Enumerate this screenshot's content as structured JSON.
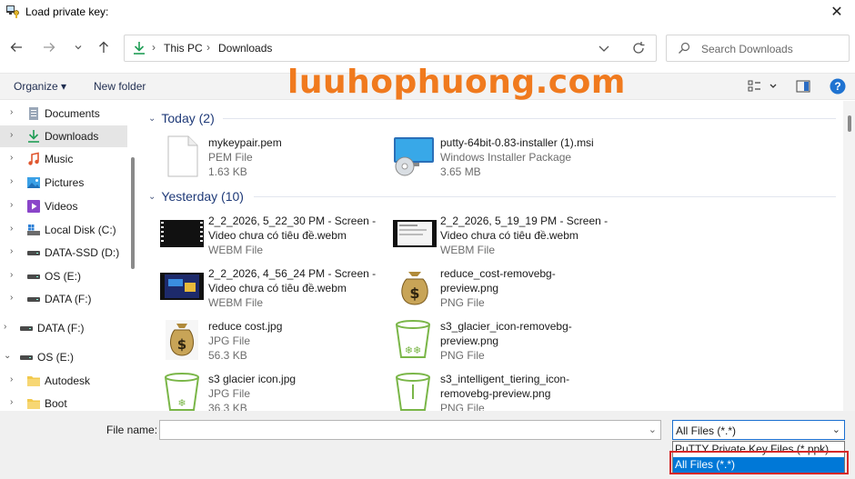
{
  "window": {
    "title": "Load private key:",
    "close_glyph": "✕"
  },
  "nav": {
    "back_icon": "arrow-left-icon",
    "forward_icon": "arrow-right-icon",
    "recent_icon": "chevron-down-icon",
    "up_icon": "arrow-up-icon",
    "breadcrumb": [
      "This PC",
      "Downloads"
    ],
    "search_placeholder": "Search Downloads"
  },
  "toolbar": {
    "organize_label": "Organize ▾",
    "new_folder_label": "New folder",
    "watermark": "luuhophuong.com",
    "help_glyph": "?"
  },
  "sidebar": {
    "items": [
      {
        "label": "Documents",
        "icon": "documents-icon"
      },
      {
        "label": "Downloads",
        "icon": "download-icon",
        "selected": true
      },
      {
        "label": "Music",
        "icon": "music-icon"
      },
      {
        "label": "Pictures",
        "icon": "pictures-icon"
      },
      {
        "label": "Videos",
        "icon": "videos-icon"
      },
      {
        "label": "Local Disk (C:)",
        "icon": "drive-icon"
      },
      {
        "label": "DATA-SSD (D:)",
        "icon": "drive-icon"
      },
      {
        "label": "OS (E:)",
        "icon": "drive-icon"
      },
      {
        "label": "DATA (F:)",
        "icon": "drive-icon"
      },
      {
        "label": "DATA (F:)",
        "icon": "drive-icon"
      },
      {
        "label": "OS (E:)",
        "icon": "drive-icon"
      },
      {
        "label": "Autodesk",
        "icon": "folder-icon"
      },
      {
        "label": "Boot",
        "icon": "folder-icon"
      }
    ]
  },
  "groups": [
    {
      "label": "Today (2)",
      "files": [
        {
          "name": "mykeypair.pem",
          "type": "PEM File",
          "size": "1.63 KB",
          "thumb": "document-icon"
        },
        {
          "name": "putty-64bit-0.83-installer (1).msi",
          "type": "Windows Installer Package",
          "size": "3.65 MB",
          "thumb": "installer-icon"
        }
      ]
    },
    {
      "label": "Yesterday (10)",
      "files": [
        {
          "name": "2_2_2026, 5_22_30 PM - Screen - Video chưa có tiêu đề.webm",
          "type": "WEBM File",
          "thumb": "video-thumb-icon"
        },
        {
          "name": "2_2_2026, 5_19_19 PM - Screen - Video chưa có tiêu đề.webm",
          "type": "WEBM File",
          "thumb": "video-thumb-icon"
        },
        {
          "name": "2_2_2026, 4_56_24 PM - Screen - Video chưa có tiêu đề.webm",
          "type": "WEBM File",
          "thumb": "video-thumb-icon"
        },
        {
          "name": "reduce_cost-removebg-preview.png",
          "type": "PNG File",
          "thumb": "money-bag-icon"
        },
        {
          "name": "reduce cost.jpg",
          "type": "JPG File",
          "size": "56.3 KB",
          "thumb": "money-bag-icon"
        },
        {
          "name": "s3_glacier_icon-removebg-preview.png",
          "type": "PNG File",
          "thumb": "bucket-icon"
        },
        {
          "name": "s3 glacier icon.jpg",
          "type": "JPG File",
          "size": "36.3 KB",
          "thumb": "bucket-icon"
        },
        {
          "name": "s3_intelligent_tiering_icon-removebg-preview.png",
          "type": "PNG File",
          "thumb": "bucket-icon"
        }
      ]
    }
  ],
  "bottom": {
    "filename_label": "File name:",
    "filename_value": "",
    "filter_value": "All Files (*.*)",
    "filter_options": [
      "PuTTY Private Key Files (*.ppk)",
      "All Files (*.*)"
    ],
    "selected_option_index": 1
  },
  "colors": {
    "accent": "#0078d7",
    "watermark": "#f07a1e",
    "highlight_box": "#d62828",
    "group_header": "#1f3a78"
  }
}
